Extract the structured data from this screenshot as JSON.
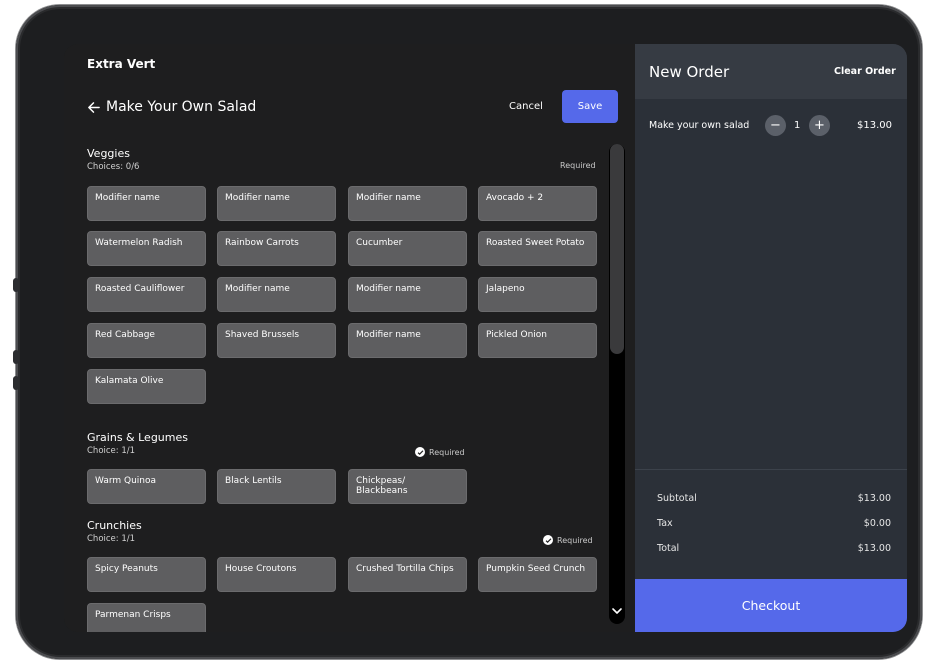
{
  "venue": "Extra Vert",
  "page_title": "Make Your Own Salad",
  "actions": {
    "cancel": "Cancel",
    "save": "Save"
  },
  "groups": {
    "veggies": {
      "title": "Veggies",
      "choices": "Choices: 0/6",
      "required": "Required",
      "items": [
        "Modifier name",
        "Modifier name",
        "Modifier name",
        "Avocado + 2",
        "Watermelon Radish",
        "Rainbow Carrots",
        "Cucumber",
        "Roasted Sweet Potato",
        "Roasted Cauliflower",
        "Modifier name",
        "Modifier name",
        "Jalapeno",
        "Red Cabbage",
        "Shaved Brussels",
        "Modifier name",
        "Pickled Onion",
        "Kalamata Olive"
      ]
    },
    "grains": {
      "title": "Grains & Legumes",
      "choices": "Choice: 1/1",
      "required": "Required",
      "items": [
        "Warm Quinoa",
        "Black Lentils",
        "Chickpeas/ Blackbeans"
      ]
    },
    "crunchies": {
      "title": "Crunchies",
      "choices": "Choice: 1/1",
      "required": "Required",
      "items": [
        "Spicy Peanuts",
        "House Croutons",
        "Crushed Tortilla Chips",
        "Pumpkin Seed Crunch",
        "Parmenan Crisps"
      ]
    }
  },
  "order": {
    "title": "New Order",
    "clear": "Clear Order",
    "line_items": [
      {
        "name": "Make your own salad",
        "qty": "1",
        "price": "$13.00"
      }
    ],
    "qty_minus": "−",
    "qty_plus": "+",
    "subtotal_label": "Subtotal",
    "subtotal": "$13.00",
    "tax_label": "Tax",
    "tax": "$0.00",
    "total_label": "Total",
    "total": "$13.00",
    "checkout": "Checkout"
  },
  "colors": {
    "accent": "#5569ea",
    "chip": "#5e5e60",
    "panel": "#2b3038"
  }
}
